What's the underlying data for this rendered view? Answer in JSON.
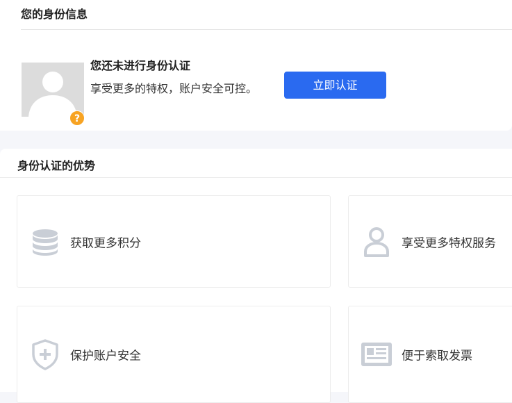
{
  "identity": {
    "title": "您的身份信息",
    "status_title": "您还未进行身份认证",
    "status_desc": "享受更多的特权，账户安全可控。",
    "verify_label": "立即认证",
    "badge": "?"
  },
  "benefits": {
    "title": "身份认证的优势",
    "items": [
      {
        "label": "获取更多积分",
        "icon": "coins-stack-icon"
      },
      {
        "label": "享受更多特权服务",
        "icon": "user-icon"
      },
      {
        "label": "保护账户安全",
        "icon": "shield-plus-icon"
      },
      {
        "label": "便于索取发票",
        "icon": "invoice-icon"
      }
    ]
  },
  "colors": {
    "accent": "#2a6af0",
    "badge": "#f7a323",
    "icon_gray": "#c9ced6"
  }
}
